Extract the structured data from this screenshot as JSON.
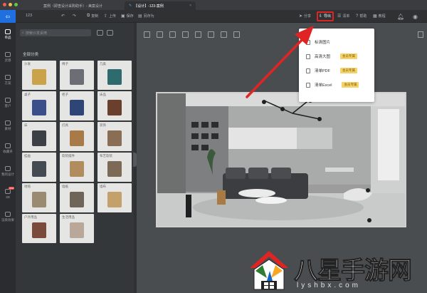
{
  "browser": {
    "tabs": [
      {
        "title": "案例（即查设计采购助手）- 美案设计"
      },
      {
        "title": "【设计】-123-案例"
      }
    ]
  },
  "iconbar": {
    "items": [
      {
        "label": "单品",
        "icon": "sofa-icon"
      },
      {
        "label": "灵感",
        "icon": "lightbulb-icon"
      },
      {
        "label": "方案",
        "icon": "layout-icon"
      },
      {
        "label": "客户",
        "icon": "user-icon"
      },
      {
        "label": "素材",
        "icon": "image-icon"
      },
      {
        "label": "收藏夹",
        "icon": "folder-icon"
      },
      {
        "label": "我的设计",
        "icon": "design-icon"
      },
      {
        "label": "3D",
        "icon": "cube-icon",
        "badge": "new"
      },
      {
        "label": "渲染效果",
        "icon": "render-icon"
      }
    ]
  },
  "toolbar": {
    "project_name": "123",
    "undo_label": "撤销",
    "redo_label": "重做",
    "copy_label": "复制",
    "upload_label": "上传",
    "save_label": "保存",
    "saveas_label": "另存为",
    "share_label": "分享",
    "export_label": "导出",
    "list_label": "清单",
    "help_label": "帮助",
    "tutorial_label": "教程"
  },
  "panel": {
    "search_placeholder": "搜索沙发桌椅",
    "category_title": "全部分类",
    "categories": [
      {
        "label": "沙发",
        "color": "#c9a24a"
      },
      {
        "label": "椅子",
        "color": "#6b6f75"
      },
      {
        "label": "几类",
        "color": "#2d6b6e"
      },
      {
        "label": "桌子",
        "color": "#3b4f8a"
      },
      {
        "label": "柜子",
        "color": "#2e4575"
      },
      {
        "label": "床品",
        "color": "#6a3f2e"
      },
      {
        "label": "床",
        "color": "#3c3f45"
      },
      {
        "label": "灯具",
        "color": "#a77a47"
      },
      {
        "label": "装饰",
        "color": "#8a6d55"
      },
      {
        "label": "挂画",
        "color": "#444a52"
      },
      {
        "label": "软装摆件",
        "color": "#b08c5e"
      },
      {
        "label": "布艺软装",
        "color": "#7c6a57"
      },
      {
        "label": "地毯",
        "color": "#9a8a72"
      },
      {
        "label": "墙纸",
        "color": "#6e6458"
      },
      {
        "label": "墙布",
        "color": "#c4a06a"
      },
      {
        "label": "户外用品",
        "color": "#7a4a3a"
      },
      {
        "label": "生活用品",
        "color": "#b9a79a"
      }
    ]
  },
  "export_menu": {
    "items": [
      {
        "label": "标清图片",
        "vip": ""
      },
      {
        "label": "高清大图",
        "vip": "会员专属"
      },
      {
        "label": "清单PDF",
        "vip": "会员专属"
      },
      {
        "label": "清单Excel",
        "vip": "会员专属"
      }
    ]
  },
  "watermark": {
    "text": "八星手游网",
    "url": "lyshbx.com"
  },
  "colors": {
    "accent": "#1f6fe0",
    "highlight": "#e02424",
    "vip_badge": "#f6d36a"
  }
}
